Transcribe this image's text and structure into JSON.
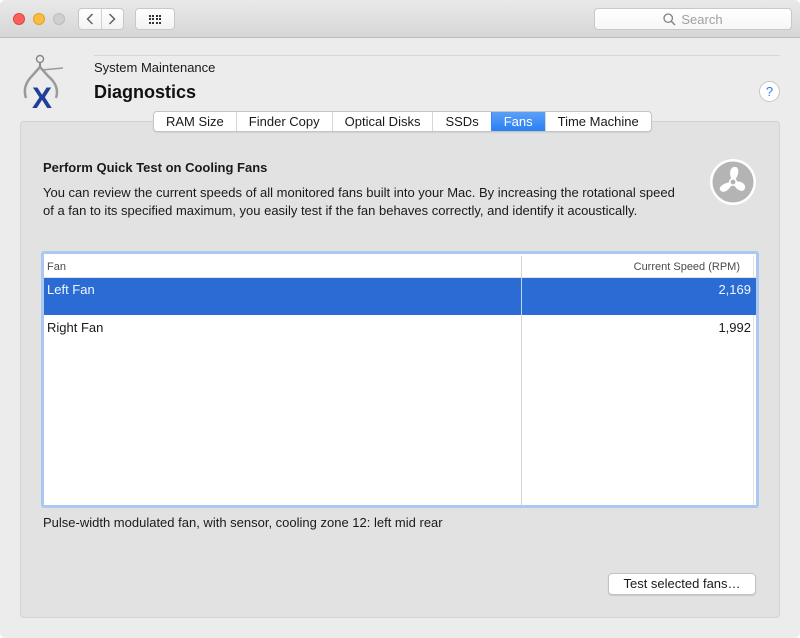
{
  "titlebar": {
    "back_icon": "chevron-left-icon",
    "forward_icon": "chevron-right-icon",
    "grid_icon": "show-all-grid-icon",
    "search": {
      "placeholder": "Search",
      "value": ""
    }
  },
  "header": {
    "subtitle": "System Maintenance",
    "title": "Diagnostics",
    "help_label": "?",
    "app_icon": "caliper-x-icon"
  },
  "tabs": [
    {
      "label": "RAM Size",
      "active": false
    },
    {
      "label": "Finder Copy",
      "active": false
    },
    {
      "label": "Optical Disks",
      "active": false
    },
    {
      "label": "SSDs",
      "active": false
    },
    {
      "label": "Fans",
      "active": true
    },
    {
      "label": "Time Machine",
      "active": false
    }
  ],
  "section": {
    "title": "Perform Quick Test on Cooling Fans",
    "description": "You can review the current speeds of all monitored fans built into your Mac. By increasing the rotational speed of a fan to its specified maximum, you easily test if the fan behaves correctly, and identify it acoustically.",
    "badge_icon": "fan-icon"
  },
  "table": {
    "columns": [
      "Fan",
      "Current Speed (RPM)"
    ],
    "rows": [
      {
        "fan": "Left Fan",
        "speed": "2,169",
        "selected": true
      },
      {
        "fan": "Right Fan",
        "speed": "1,992",
        "selected": false
      }
    ]
  },
  "status_text": "Pulse-width modulated fan, with sensor, cooling zone 12: left mid rear",
  "actions": {
    "test_button": "Test selected fans…"
  },
  "colors": {
    "accent": "#2a7ff2",
    "selection": "#2a6bd4",
    "focus_ring": "#a9c9f2"
  }
}
